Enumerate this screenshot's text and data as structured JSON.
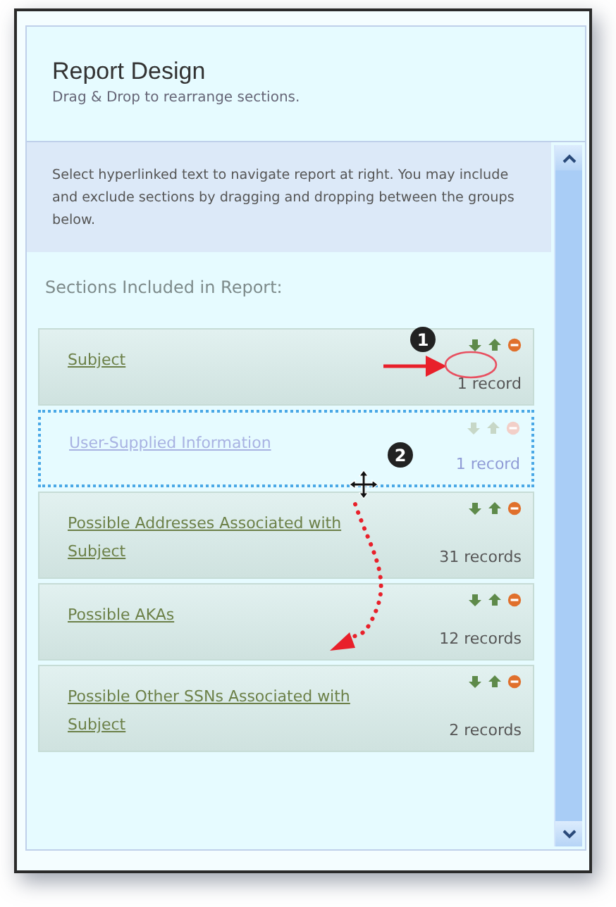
{
  "panel": {
    "title": "Report Design",
    "subtitle": "Drag & Drop to rearrange sections."
  },
  "info": "Select hyperlinked text to navigate report at right. You may include and exclude sections by dragging and dropping between the groups below.",
  "sections_heading": "Sections Included in Report:",
  "sections": [
    {
      "title": "Subject",
      "records": "1 record",
      "dragging": false
    },
    {
      "title": "User-Supplied Information",
      "records": "1 record",
      "dragging": true
    },
    {
      "title": "Possible Addresses Associated with Subject",
      "records": "31 records",
      "dragging": false
    },
    {
      "title": "Possible AKAs",
      "records": "12 records",
      "dragging": false
    },
    {
      "title": "Possible Other SSNs Associated with Subject",
      "records": "2 records",
      "dragging": false
    }
  ],
  "annotations": {
    "callouts": [
      "1",
      "2"
    ]
  }
}
